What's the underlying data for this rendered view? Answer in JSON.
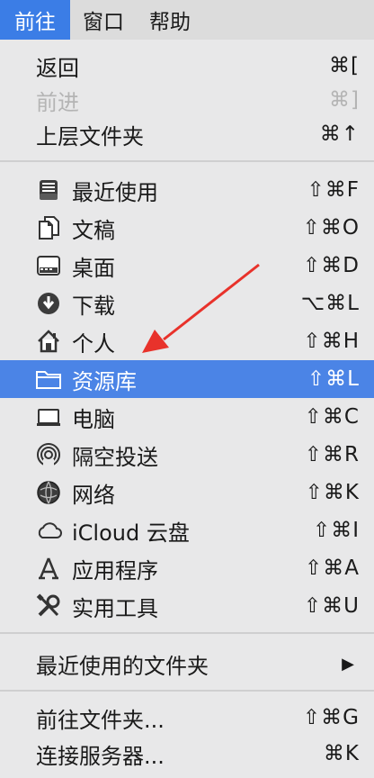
{
  "menubar": {
    "items": [
      {
        "label": "前往"
      },
      {
        "label": "窗口"
      },
      {
        "label": "帮助"
      }
    ]
  },
  "menu": {
    "group1": [
      {
        "label": "返回",
        "shortcut": "⌘["
      },
      {
        "label": "前进",
        "shortcut": "⌘]",
        "disabled": true
      },
      {
        "label": "上层文件夹",
        "shortcut": "⌘↑"
      }
    ],
    "group2": [
      {
        "label": "最近使用",
        "shortcut": "⇧⌘F",
        "icon": "recents-icon"
      },
      {
        "label": "文稿",
        "shortcut": "⇧⌘O",
        "icon": "documents-icon"
      },
      {
        "label": "桌面",
        "shortcut": "⇧⌘D",
        "icon": "desktop-icon"
      },
      {
        "label": "下载",
        "shortcut": "⌥⌘L",
        "icon": "downloads-icon"
      },
      {
        "label": "个人",
        "shortcut": "⇧⌘H",
        "icon": "home-icon"
      },
      {
        "label": "资源库",
        "shortcut": "⇧⌘L",
        "icon": "folder-icon",
        "highlighted": true
      },
      {
        "label": "电脑",
        "shortcut": "⇧⌘C",
        "icon": "computer-icon"
      },
      {
        "label": "隔空投送",
        "shortcut": "⇧⌘R",
        "icon": "airdrop-icon"
      },
      {
        "label": "网络",
        "shortcut": "⇧⌘K",
        "icon": "network-icon"
      },
      {
        "label": "iCloud 云盘",
        "shortcut": "⇧⌘I",
        "icon": "icloud-icon"
      },
      {
        "label": "应用程序",
        "shortcut": "⇧⌘A",
        "icon": "applications-icon"
      },
      {
        "label": "实用工具",
        "shortcut": "⇧⌘U",
        "icon": "utilities-icon"
      }
    ],
    "group3": [
      {
        "label": "最近使用的文件夹",
        "submenu_arrow": "▶"
      }
    ],
    "group4": [
      {
        "label": "前往文件夹...",
        "shortcut": "⇧⌘G"
      },
      {
        "label": "连接服务器...",
        "shortcut": "⌘K"
      }
    ]
  },
  "colors": {
    "highlight": "#4b84e6",
    "annotation_arrow": "#e8322b"
  }
}
